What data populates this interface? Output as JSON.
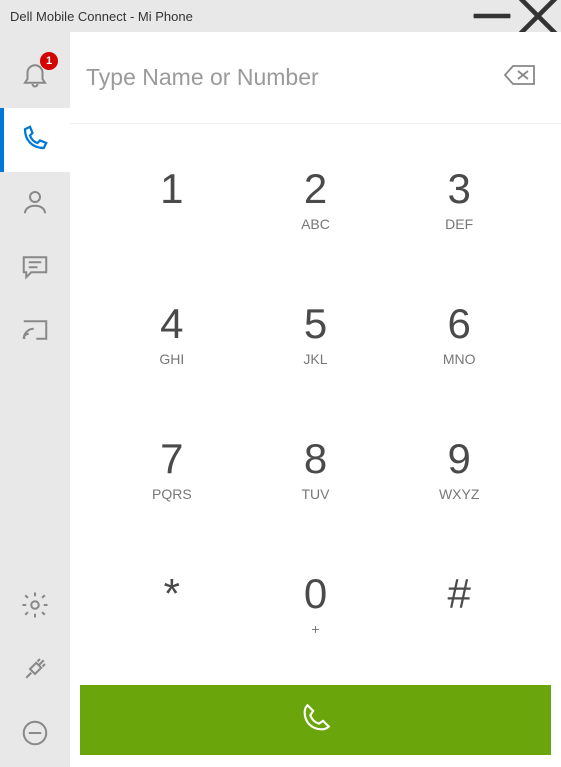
{
  "window": {
    "title": "Dell Mobile Connect - Mi Phone"
  },
  "sidebar": {
    "notifications_badge": "1"
  },
  "dialer": {
    "placeholder": "Type Name or Number",
    "value": ""
  },
  "keys": [
    {
      "digit": "1",
      "letters": ""
    },
    {
      "digit": "2",
      "letters": "ABC"
    },
    {
      "digit": "3",
      "letters": "DEF"
    },
    {
      "digit": "4",
      "letters": "GHI"
    },
    {
      "digit": "5",
      "letters": "JKL"
    },
    {
      "digit": "6",
      "letters": "MNO"
    },
    {
      "digit": "7",
      "letters": "PQRS"
    },
    {
      "digit": "8",
      "letters": "TUV"
    },
    {
      "digit": "9",
      "letters": "WXYZ"
    },
    {
      "digit": "*",
      "letters": ""
    },
    {
      "digit": "0",
      "letters": "+"
    },
    {
      "digit": "#",
      "letters": ""
    }
  ]
}
